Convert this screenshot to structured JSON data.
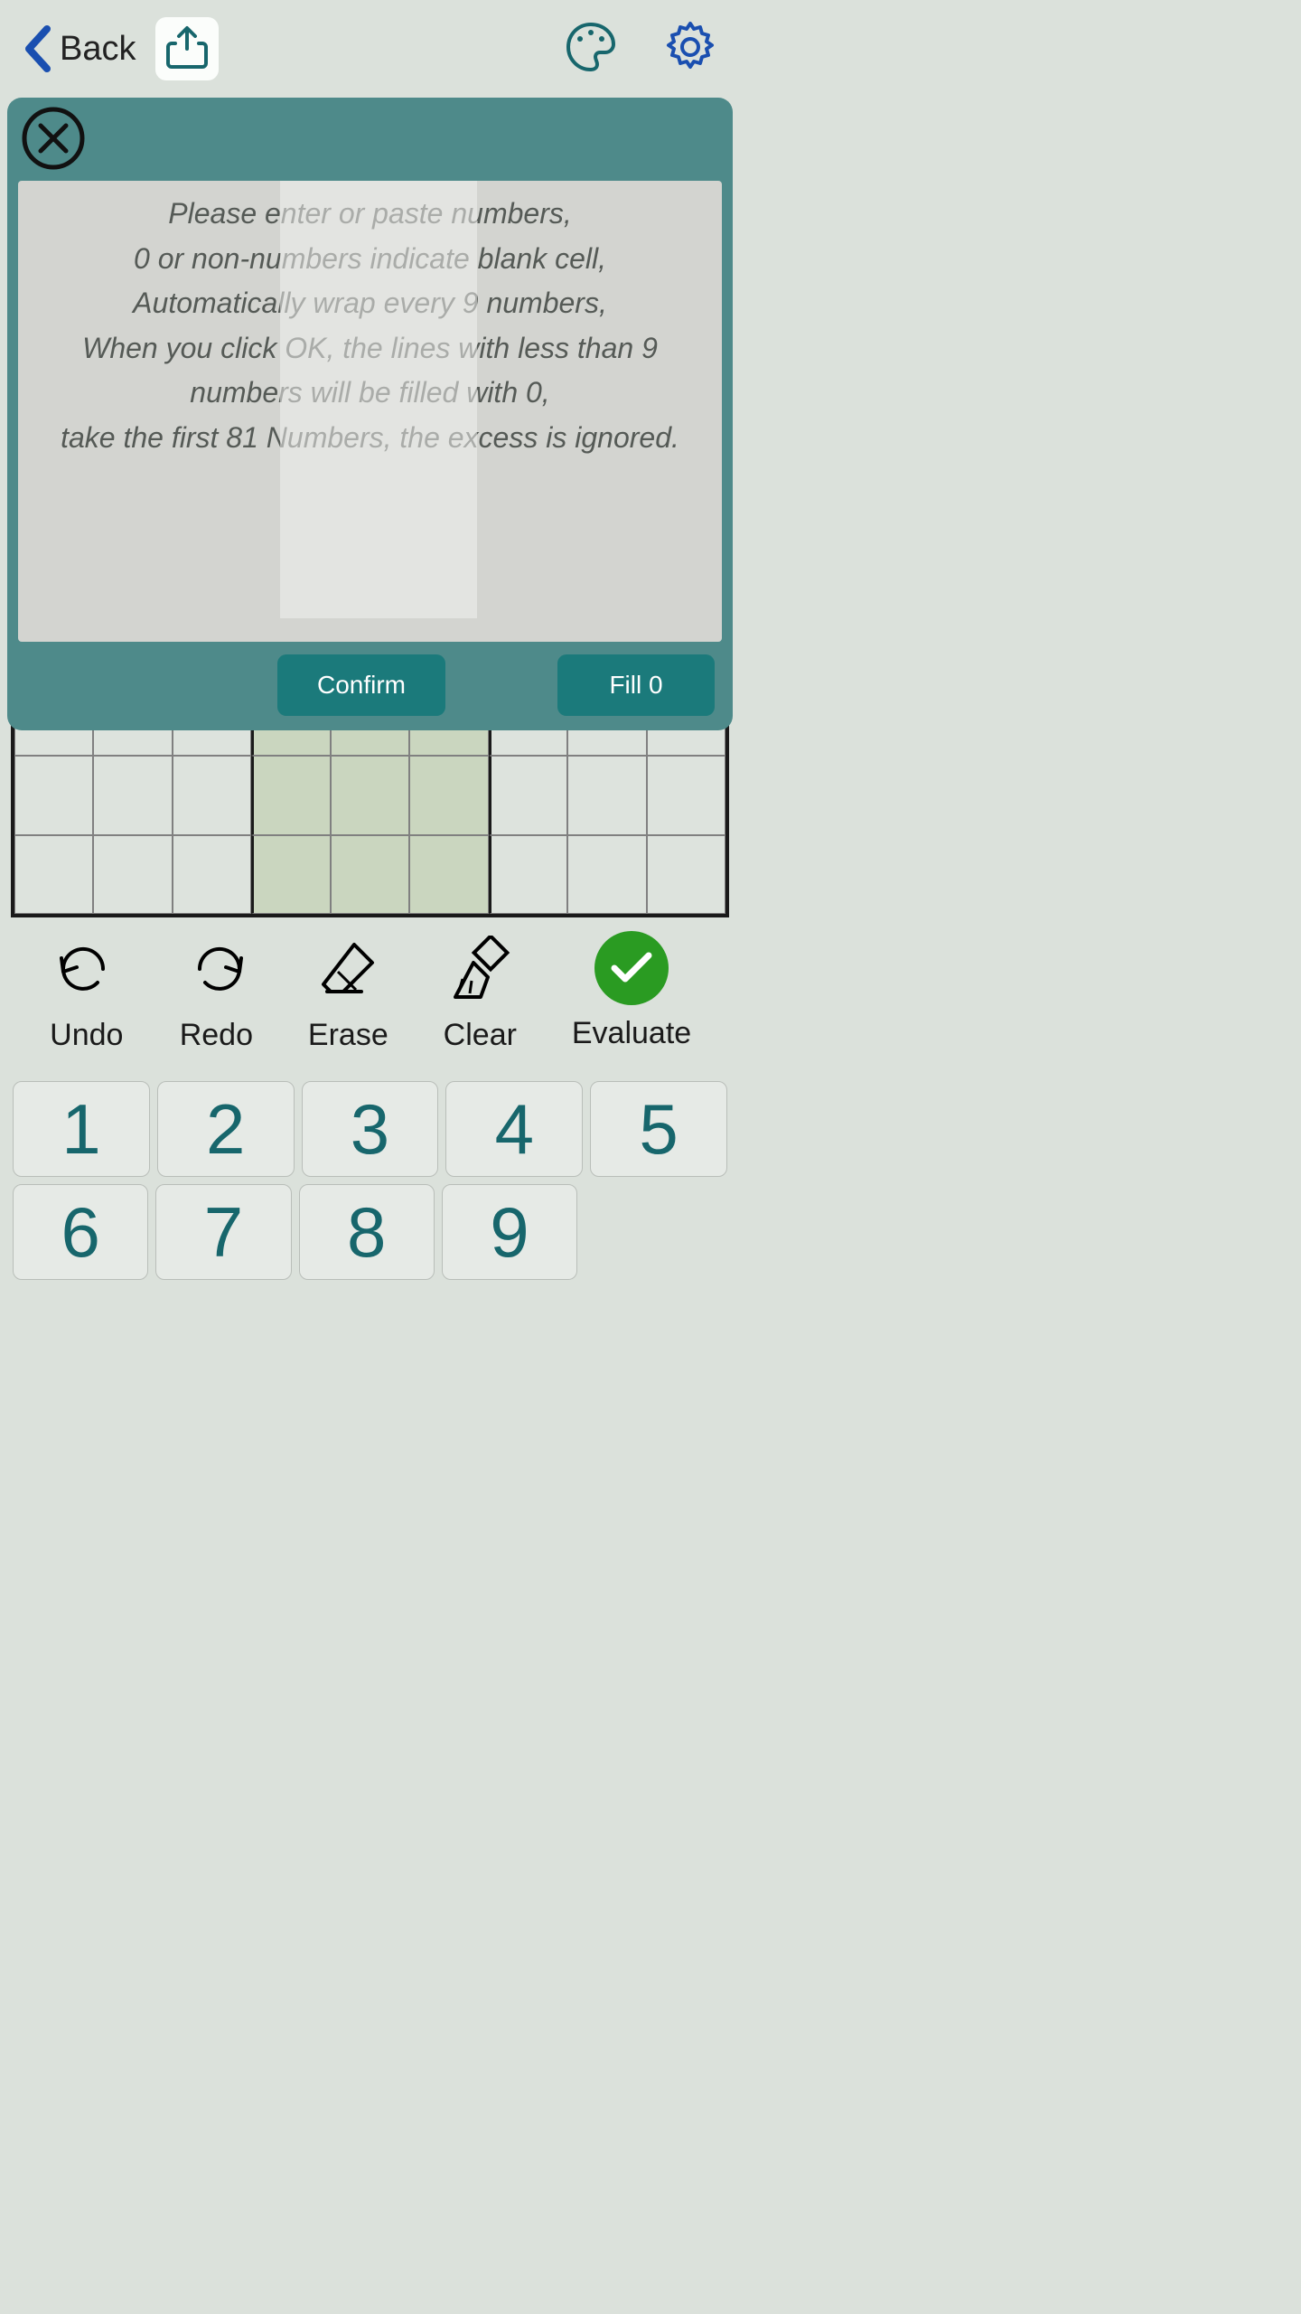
{
  "topbar": {
    "back_label": "Back"
  },
  "modal": {
    "instructions": "Please enter or paste numbers,\n0 or non-numbers indicate blank cell,\nAutomatically wrap every 9 numbers,\nWhen you click OK, the lines with less than 9 numbers will be filled with 0,\ntake the first 81 Numbers, the excess is ignored.",
    "confirm_label": "Confirm",
    "fill0_label": "Fill 0",
    "input_value": ""
  },
  "actions": {
    "undo": "Undo",
    "redo": "Redo",
    "erase": "Erase",
    "clear": "Clear",
    "evaluate": "Evaluate"
  },
  "numpad": {
    "k1": "1",
    "k2": "2",
    "k3": "3",
    "k4": "4",
    "k5": "5",
    "k6": "6",
    "k7": "7",
    "k8": "8",
    "k9": "9"
  },
  "colors": {
    "accent_dark_teal": "#1b7a7b",
    "panel_teal": "#4e8a8a",
    "number_teal": "#17666c",
    "evaluate_green": "#2a9b22",
    "nav_blue": "#1a4fb0"
  }
}
